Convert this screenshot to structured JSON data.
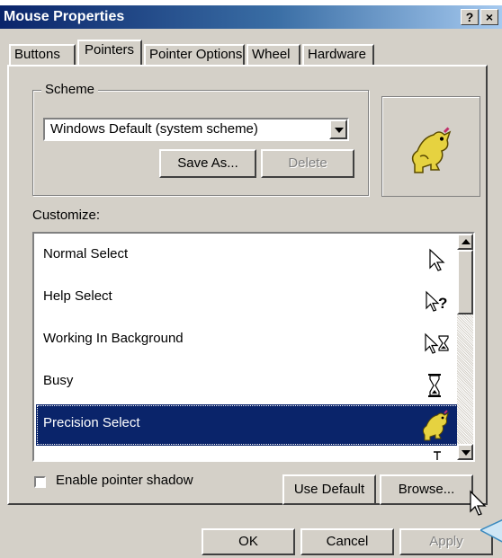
{
  "window": {
    "title": "Mouse Properties",
    "help_button": "?",
    "close_button": "×"
  },
  "tabs": [
    {
      "label": "Buttons",
      "active": false
    },
    {
      "label": "Pointers",
      "active": true
    },
    {
      "label": "Pointer Options",
      "active": false
    },
    {
      "label": "Wheel",
      "active": false
    },
    {
      "label": "Hardware",
      "active": false
    }
  ],
  "scheme": {
    "group_label": "Scheme",
    "selected": "Windows Default (system scheme)",
    "save_as_label": "Save As...",
    "delete_label": "Delete",
    "preview_icon": "dinosaur-cursor-icon"
  },
  "customize": {
    "label": "Customize:",
    "items": [
      {
        "label": "Normal Select",
        "icon": "arrow-cursor-icon",
        "selected": false
      },
      {
        "label": "Help Select",
        "icon": "help-cursor-icon",
        "selected": false
      },
      {
        "label": "Working In Background",
        "icon": "working-cursor-icon",
        "selected": false
      },
      {
        "label": "Busy",
        "icon": "hourglass-cursor-icon",
        "selected": false
      },
      {
        "label": "Precision Select",
        "icon": "dinosaur-cursor-icon",
        "selected": true
      }
    ]
  },
  "options": {
    "enable_shadow_label": "Enable pointer shadow",
    "enable_shadow_checked": false,
    "use_default_label": "Use Default",
    "browse_label": "Browse..."
  },
  "footer": {
    "ok_label": "OK",
    "cancel_label": "Cancel",
    "apply_label": "Apply"
  },
  "colors": {
    "selection": "#0a246a",
    "face": "#d4d0c8",
    "title_gradient_start": "#0a246a",
    "title_gradient_end": "#a6caf0"
  }
}
